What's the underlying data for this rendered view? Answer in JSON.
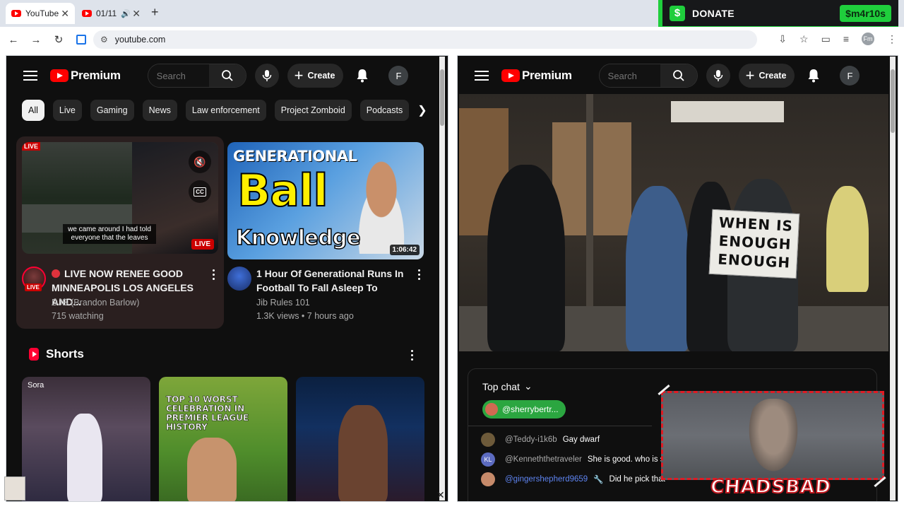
{
  "browser": {
    "tabs": [
      {
        "label": "YouTube",
        "active": true
      },
      {
        "label": "01/11",
        "active": false
      }
    ],
    "url": "youtube.com"
  },
  "overlay": {
    "donate_label": "DONATE",
    "cashtag": "$m4r10s",
    "webcam_name": "CHADSBAD"
  },
  "left": {
    "logo_text": "Premium",
    "search_placeholder": "Search",
    "create_label": "Create",
    "avatar_letter": "F",
    "chips": [
      "All",
      "Live",
      "Gaming",
      "News",
      "Law enforcement",
      "Project Zomboid",
      "Podcasts"
    ],
    "videos": [
      {
        "title": "LIVE NOW RENEE GOOD MINNEAPOLIS LOS ANGELES AND...",
        "channel": "DJB (Brandon Barlow)",
        "stats": "715 watching",
        "caption": "we came around I had told everyone that the leaves",
        "badge": "LIVE",
        "thumb_tag": "LIVE",
        "avatar_badge": "LIVE"
      },
      {
        "title": "1 Hour Of Generational Runs In Football To Fall Asleep To",
        "channel": "Jib Rules 101",
        "stats": "1.3K views • 7 hours ago",
        "thumb_line1": "GENERATIONAL",
        "thumb_line2": "Ball",
        "thumb_line3": "Knowledge",
        "duration": "1:06:42"
      }
    ],
    "shorts_title": "Shorts",
    "shorts": [
      {
        "label": "Sora"
      },
      {
        "label": "TOP 10 WORST CELEBRATION IN PREMIER LEAGUE HISTORY"
      },
      {
        "label": ""
      }
    ]
  },
  "right": {
    "logo_text": "Premium",
    "search_placeholder": "Search",
    "create_label": "Create",
    "avatar_letter": "F",
    "sign_text": "WHEN IS ENOUGH ENOUGH",
    "chat": {
      "mode": "Top chat",
      "pinned_author": "@sherrybertr...",
      "messages": [
        {
          "author": "@Teddy-i1k6b",
          "text": "Gay dwarf",
          "member": false
        },
        {
          "author": "@Kenneththetraveler",
          "text": "She is good. who is sh?",
          "member": false,
          "initials": "KL"
        },
        {
          "author": "@gingershepherd9659",
          "text": "Did he pick that",
          "member": true
        }
      ]
    }
  },
  "colors": {
    "yt_red": "#ff0000",
    "cashapp_green": "#1fce3c",
    "chat_member_blue": "#5e84f1",
    "pinned_green": "#2ba640"
  }
}
